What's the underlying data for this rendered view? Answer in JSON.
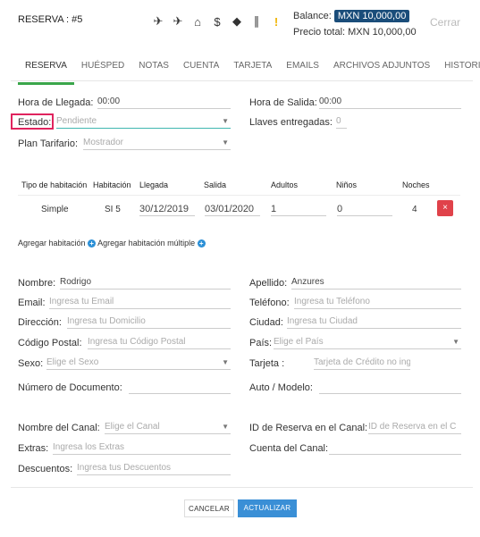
{
  "header": {
    "title": "RESERVA : #5",
    "icons": [
      "plane-departure-icon",
      "plane-arrival-icon",
      "lock-icon",
      "dollar-icon",
      "tag-icon",
      "paperclip-icon",
      "warning-icon"
    ],
    "balance_label": "Balance:",
    "balance_value": "MXN 10,000,00",
    "precio_total": "Precio total: MXN 10,000,00",
    "cerrar": "Cerrar"
  },
  "tabs": [
    "RESERVA",
    "HUÉSPED",
    "NOTAS",
    "CUENTA",
    "TARJETA",
    "EMAILS",
    "ARCHIVOS ADJUNTOS",
    "HISTORIAL"
  ],
  "reserva": {
    "hora_llegada_label": "Hora de Llegada:",
    "hora_llegada": "00:00",
    "hora_salida_label": "Hora de Salida:",
    "hora_salida": "00:00",
    "estado_label": "Estado:",
    "estado_value": "Pendiente",
    "llaves_label": "Llaves entregadas:",
    "llaves_value": "0",
    "plan_label": "Plan Tarifario:",
    "plan_value": "Mostrador"
  },
  "rooms": {
    "headers": [
      "Tipo de habitación",
      "Habitación",
      "Llegada",
      "Salida",
      "Adultos",
      "Niños",
      "Noches"
    ],
    "rows": [
      {
        "tipo": "Simple",
        "habitacion": "SI 5",
        "llegada": "30/12/2019",
        "salida": "03/01/2020",
        "adultos": "1",
        "ninos": "0",
        "noches": "4"
      }
    ],
    "delete_label": "×",
    "add_room": "Agregar habitación",
    "add_multiple": "Agregar habitación múltiple"
  },
  "guest": {
    "nombre_label": "Nombre:",
    "nombre_value": "Rodrigo",
    "apellido_label": "Apellido:",
    "apellido_value": "Anzures",
    "email_label": "Email:",
    "email_ph": "Ingresa tu Email",
    "telefono_label": "Teléfono:",
    "telefono_ph": "Ingresa tu Teléfono",
    "direccion_label": "Dirección:",
    "direccion_ph": "Ingresa tu Domicilio",
    "ciudad_label": "Ciudad:",
    "ciudad_ph": "Ingresa tu Ciudad",
    "cp_label": "Código Postal:",
    "cp_ph": "Ingresa tu Código Postal",
    "pais_label": "País:",
    "pais_ph": "Elige el País",
    "sexo_label": "Sexo:",
    "sexo_ph": "Elige el Sexo",
    "tarjeta_label": "Tarjeta :",
    "tarjeta_ph": "Tarjeta de Crédito no ingre",
    "documento_label": "Número de Documento:",
    "auto_label": "Auto / Modelo:"
  },
  "canal": {
    "nombre_label": "Nombre del Canal:",
    "nombre_ph": "Elige el Canal",
    "id_label": "ID de Reserva en el Canal:",
    "id_ph": "ID de Reserva en el C",
    "extras_label": "Extras:",
    "extras_ph": "Ingresa los Extras",
    "cuenta_label": "Cuenta del Canal:",
    "descuentos_label": "Descuentos:",
    "descuentos_ph": "Ingresa tus Descuentos"
  },
  "buttons": {
    "cancel": "CANCELAR",
    "update": "ACTUALIZAR"
  }
}
